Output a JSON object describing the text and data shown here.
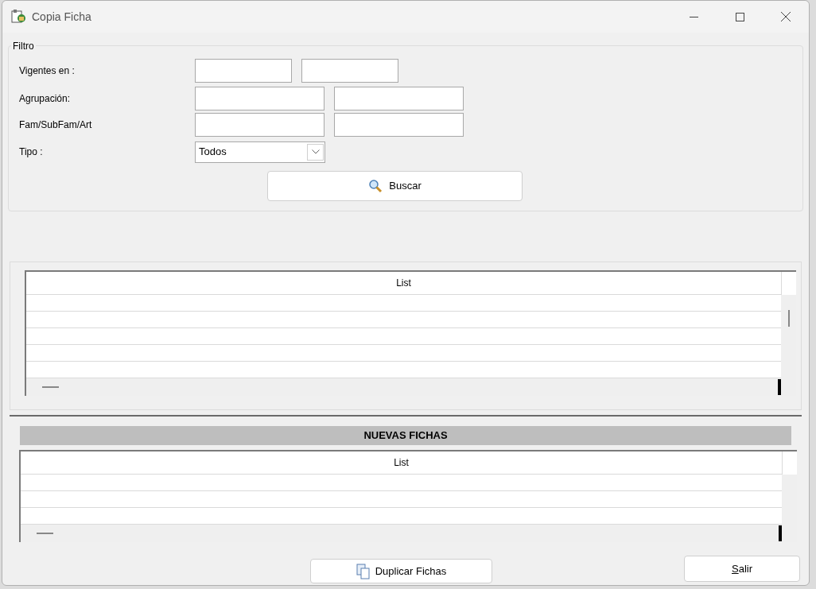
{
  "window": {
    "title": "Copia Ficha"
  },
  "filter": {
    "legend": "Filtro",
    "rows": [
      {
        "label": "Vigentes en :",
        "kind": "text"
      },
      {
        "label": "Agrupación:",
        "kind": "text"
      },
      {
        "label": "Fam/SubFam/Art",
        "kind": "text"
      },
      {
        "label": "Tipo :",
        "kind": "select",
        "value": "Todos"
      }
    ],
    "search_button": "Buscar"
  },
  "list_1": {
    "header": "List"
  },
  "new_section": {
    "title": "NUEVAS FICHAS",
    "list": {
      "header": "List"
    }
  },
  "buttons": {
    "duplicate": "Duplicar Fichas",
    "exit": "Salir"
  }
}
